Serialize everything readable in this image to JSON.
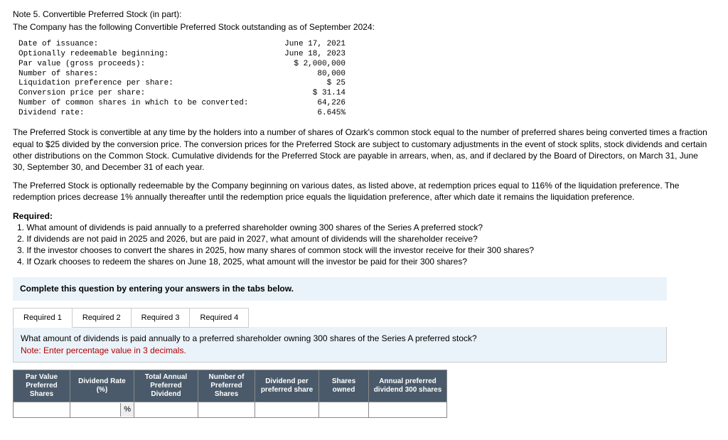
{
  "header": {
    "title": "Note 5. Convertible Preferred Stock (in part):",
    "subtitle": "The Company has the following Convertible Preferred Stock outstanding as of September 2024:"
  },
  "stock_data": [
    {
      "label": "Date of issuance:",
      "value": "June 17, 2021"
    },
    {
      "label": "Optionally redeemable beginning:",
      "value": "June 18, 2023"
    },
    {
      "label": "Par value (gross proceeds):",
      "value": "$ 2,000,000"
    },
    {
      "label": "Number of shares:",
      "value": "80,000"
    },
    {
      "label": "Liquidation preference per share:",
      "value": "$ 25"
    },
    {
      "label": "Conversion price per share:",
      "value": "$ 31.14"
    },
    {
      "label": "Number of common shares in which to be converted:",
      "value": "64,226"
    },
    {
      "label": "Dividend rate:",
      "value": "6.645%"
    }
  ],
  "paragraphs": {
    "p1": "The Preferred Stock is convertible at any time by the holders into a number of shares of Ozark's common stock equal to the number of preferred shares being converted times a fraction equal to $25 divided by the conversion price. The conversion prices for the Preferred Stock are subject to customary adjustments in the event of stock splits, stock dividends and certain other distributions on the Common Stock. Cumulative dividends for the Preferred Stock are payable in arrears, when, as, and if declared by the Board of Directors, on March 31, June 30, September 30, and December 31 of each year.",
    "p2": "The Preferred Stock is optionally redeemable by the Company beginning on various dates, as listed above, at redemption prices equal to 116% of the liquidation preference. The redemption prices decrease 1% annually thereafter until the redemption price equals the liquidation preference, after which date it remains the liquidation preference."
  },
  "required": {
    "heading": "Required:",
    "items": [
      "1. What amount of dividends is paid annually to a preferred shareholder owning 300 shares of the Series A preferred stock?",
      "2. If dividends are not paid in 2025 and 2026, but are paid in 2027, what amount of dividends will the shareholder receive?",
      "3. If the investor chooses to convert the shares in 2025, how many shares of common stock will the investor receive for their 300 shares?",
      "4. If Ozark chooses to redeem the shares on June 18, 2025, what amount will the investor be paid for their 300 shares?"
    ]
  },
  "instruction_box": "Complete this question by entering your answers in the tabs below.",
  "tabs": [
    {
      "label": "Required 1"
    },
    {
      "label": "Required 2"
    },
    {
      "label": "Required 3"
    },
    {
      "label": "Required 4"
    }
  ],
  "question": {
    "text": "What amount of dividends is paid annually to a preferred shareholder owning 300 shares of the Series A preferred stock?",
    "note": "Note: Enter percentage value in 3 decimals."
  },
  "table_headers": [
    "Par Value Preferred Shares",
    "Dividend Rate (%)",
    "Total Annual Preferred Dividend",
    "Number of Preferred Shares",
    "Dividend per preferred share",
    "Shares owned",
    "Annual preferred dividend 300 shares"
  ],
  "pct_symbol": "%"
}
